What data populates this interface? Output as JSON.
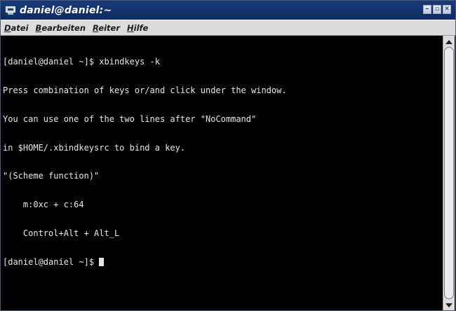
{
  "window": {
    "title": "daniel@daniel:~",
    "buttons": [
      "–",
      "▫",
      "✕"
    ]
  },
  "menu": {
    "items": [
      {
        "mnemonic": "D",
        "rest": "atei"
      },
      {
        "mnemonic": "B",
        "rest": "earbeiten"
      },
      {
        "mnemonic": "R",
        "rest": "eiter"
      },
      {
        "mnemonic": "H",
        "rest": "ilfe"
      }
    ]
  },
  "terminal": {
    "lines": [
      "[daniel@daniel ~]$ xbindkeys -k",
      "Press combination of keys or/and click under the window.",
      "You can use one of the two lines after \"NoCommand\"",
      "in $HOME/.xbindkeysrc to bind a key.",
      "\"(Scheme function)\"",
      "    m:0xc + c:64",
      "    Control+Alt + Alt_L"
    ],
    "prompt": "[daniel@daniel ~]$ "
  },
  "scrollbar": {
    "position_fraction": 0.0,
    "visible_fraction": 1.0
  }
}
